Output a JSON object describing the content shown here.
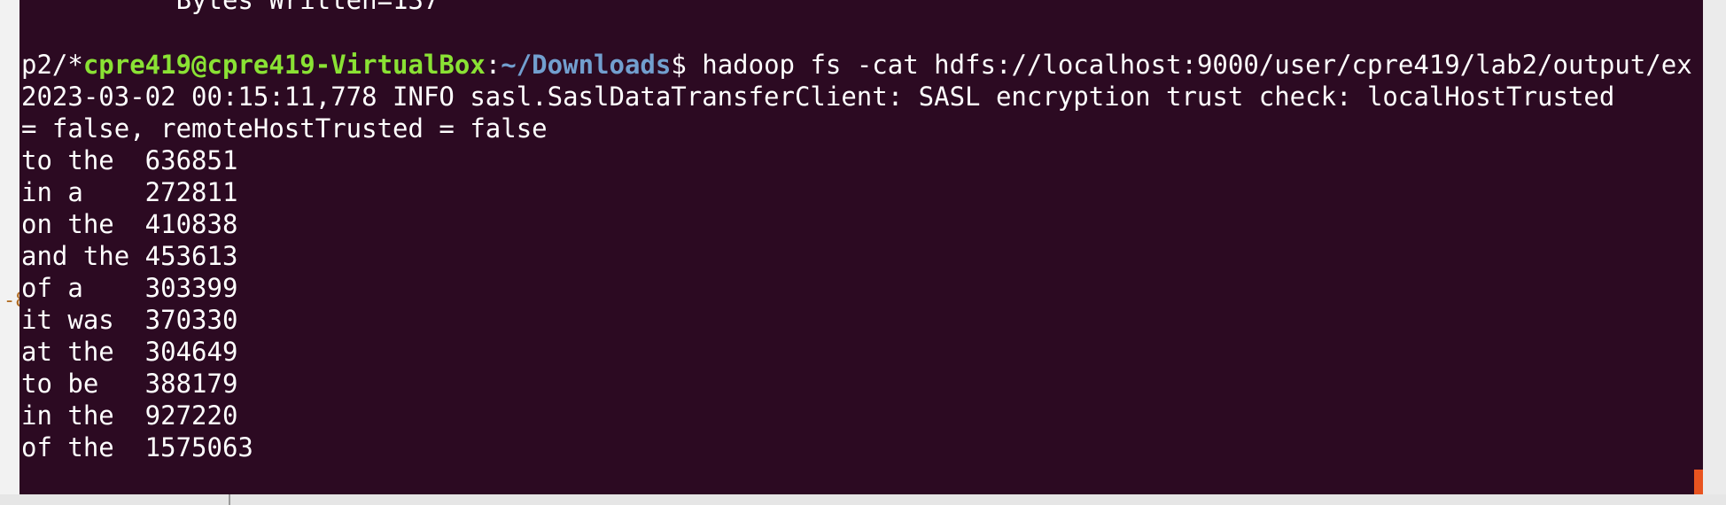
{
  "left_edge_glyph": "-8",
  "terminal": {
    "prev_output_line": "          Bytes Written=137",
    "prompt": {
      "user_host": "cpre419@cpre419-VirtualBox",
      "sep": ":",
      "path": "~/Downloads",
      "dollar": "$ "
    },
    "command_line1": "hadoop fs -cat hdfs://localhost:9000/user/cpre419/lab2/output/ex",
    "command_line2": "p2/*",
    "info_line1": "2023-03-02 00:15:11,778 INFO sasl.SaslDataTransferClient: SASL encryption trust check: localHostTrusted",
    "info_line2": "= false, remoteHostTrusted = false",
    "results": [
      {
        "text": "to the  636851"
      },
      {
        "text": "in a    272811"
      },
      {
        "text": "on the  410838"
      },
      {
        "text": "and the 453613"
      },
      {
        "text": "of a    303399"
      },
      {
        "text": "it was  370330"
      },
      {
        "text": "at the  304649"
      },
      {
        "text": "to be   388179"
      },
      {
        "text": "in the  927220"
      },
      {
        "text": "of the  1575063"
      }
    ],
    "colors": {
      "background": "#2c0a22",
      "prompt_user": "#8ae234",
      "prompt_path": "#729fcf",
      "text": "#ffffff",
      "scroll_marker": "#e95420"
    }
  }
}
